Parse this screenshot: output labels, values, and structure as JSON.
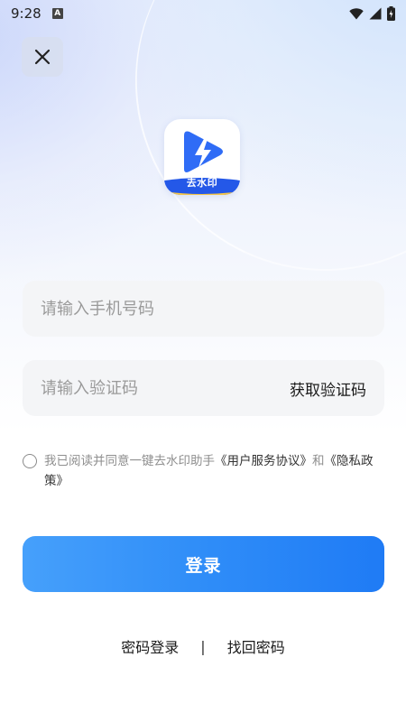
{
  "status_bar": {
    "time": "9:28",
    "notification_letter": "A",
    "icons": [
      "wifi-icon",
      "signal-icon",
      "battery-icon"
    ]
  },
  "header": {
    "close_icon": "close-icon"
  },
  "logo": {
    "text": "去水印",
    "colors": {
      "blue": "#2f6cf6",
      "bolt": "#ffffff"
    }
  },
  "form": {
    "phone_placeholder": "请输入手机号码",
    "phone_value": "",
    "code_placeholder": "请输入验证码",
    "code_value": "",
    "get_code_label": "获取验证码"
  },
  "agreement": {
    "checked": false,
    "prefix": "我已阅读并同意一键去水印助手",
    "user_agreement": "《用户服务协议》",
    "connector": "和",
    "privacy_policy": "《隐私政策》"
  },
  "login_button": {
    "label": "登录",
    "color": "#2f8df8"
  },
  "bottom_links": {
    "password_login": "密码登录",
    "separator": "|",
    "recover_password": "找回密码"
  }
}
